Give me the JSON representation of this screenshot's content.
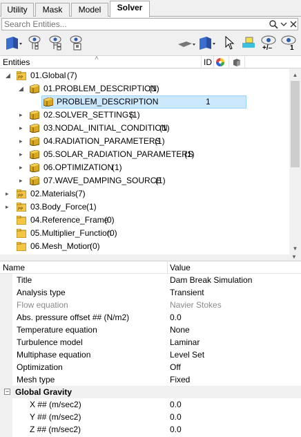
{
  "tabs": [
    {
      "label": "Utility"
    },
    {
      "label": "Mask"
    },
    {
      "label": "Model"
    },
    {
      "label": "Solver"
    }
  ],
  "search": {
    "placeholder": "Search Entities..."
  },
  "toolbar": {
    "show_label": "+/–",
    "count_label": "1"
  },
  "entities_header": {
    "title": "Entities",
    "id_col": "ID"
  },
  "tree": [
    {
      "label": "01.Global",
      "count": "(7)"
    },
    {
      "label": "01.PROBLEM_DESCRIPTION",
      "count": "(1)"
    },
    {
      "label": "PROBLEM_DESCRIPTION",
      "id": "1"
    },
    {
      "label": "02.SOLVER_SETTINGS",
      "count": "(1)"
    },
    {
      "label": "03.NODAL_INITIAL_CONDITION",
      "count": "(1)"
    },
    {
      "label": "04.RADIATION_PARAMETERS",
      "count": "(1)"
    },
    {
      "label": "05.SOLAR_RADIATION_PARAMETERS",
      "count": "(1)"
    },
    {
      "label": "06.OPTIMIZATION",
      "count": "(1)"
    },
    {
      "label": "07.WAVE_DAMPING_SOURCE",
      "count": "(1)"
    },
    {
      "label": "02.Materials",
      "count": "(7)"
    },
    {
      "label": "03.Body_Force",
      "count": "(1)"
    },
    {
      "label": "04.Reference_Frame",
      "count": "(0)"
    },
    {
      "label": "05.Multiplier_Function",
      "count": "(0)"
    },
    {
      "label": "06.Mesh_Motion",
      "count": "(0)"
    }
  ],
  "properties": {
    "header": {
      "name": "Name",
      "value": "Value"
    },
    "rows": [
      {
        "name": "Title",
        "value": "Dam Break Simulation"
      },
      {
        "name": "Analysis type",
        "value": "Transient"
      },
      {
        "name": "Flow equation",
        "value": "Navier Stokes"
      },
      {
        "name": "Abs. pressure offset ## (N/m2)",
        "value": "0.0"
      },
      {
        "name": "Temperature equation",
        "value": "None"
      },
      {
        "name": "Turbulence model",
        "value": "Laminar"
      },
      {
        "name": "Multiphase equation",
        "value": "Level Set"
      },
      {
        "name": "Optimization",
        "value": "Off"
      },
      {
        "name": "Mesh type",
        "value": "Fixed"
      }
    ],
    "group": {
      "label": "Global Gravity"
    },
    "gravity": [
      {
        "name": "X ## (m/sec2)",
        "value": "0.0"
      },
      {
        "name": "Y ## (m/sec2)",
        "value": "0.0"
      },
      {
        "name": "Z ## (m/sec2)",
        "value": "0.0"
      }
    ]
  },
  "colors": {
    "selection": "#cce8ff",
    "folder": "#f5c542",
    "tab_active": "#ffffff"
  }
}
